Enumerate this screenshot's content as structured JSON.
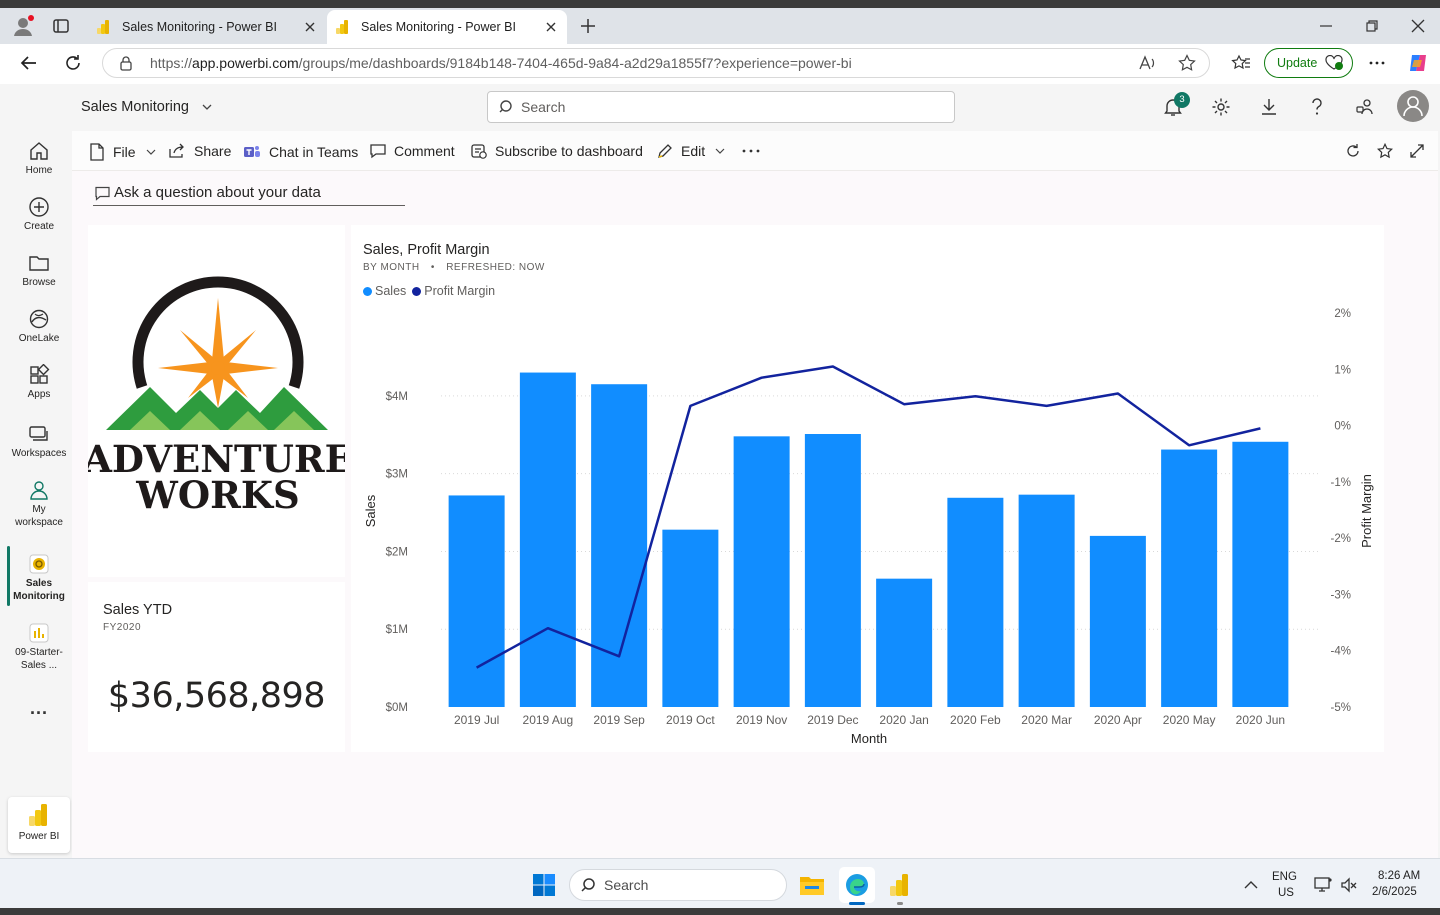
{
  "browser": {
    "tabs": [
      {
        "title": "Sales Monitoring - Power BI",
        "active": false
      },
      {
        "title": "Sales Monitoring - Power BI",
        "active": true
      }
    ],
    "url_prefix": "https://",
    "url_host": "app.powerbi.com",
    "url_path": "/groups/me/dashboards/9184b148-7404-465d-9a84-a2d29a1855f7?experience=power-bi",
    "update_label": "Update"
  },
  "appbar": {
    "workspace_title": "Sales Monitoring",
    "search_placeholder": "Search",
    "notification_count": "3"
  },
  "nav": {
    "items": [
      {
        "label": "Home",
        "icon": "home-icon"
      },
      {
        "label": "Create",
        "icon": "plus-circle-icon"
      },
      {
        "label": "Browse",
        "icon": "folder-icon"
      },
      {
        "label": "OneLake",
        "icon": "onelake-icon"
      },
      {
        "label": "Apps",
        "icon": "apps-icon"
      },
      {
        "label": "Workspaces",
        "icon": "workspaces-icon"
      },
      {
        "label_line1": "My",
        "label_line2": "workspace",
        "icon": "person-icon"
      },
      {
        "label_line1": "Sales",
        "label_line2": "Monitoring",
        "icon": "dashboard-icon",
        "selected": true
      },
      {
        "label_line1": "09-Starter-",
        "label_line2": "Sales ...",
        "icon": "report-icon"
      }
    ],
    "more": "...",
    "brand_label": "Power BI"
  },
  "toolbar": {
    "file": "File",
    "share": "Share",
    "chat_in_teams": "Chat in Teams",
    "comment": "Comment",
    "subscribe": "Subscribe to dashboard",
    "edit": "Edit"
  },
  "qna": {
    "placeholder": "Ask a question about your data"
  },
  "logo": {
    "line1": "ADVENTURE",
    "line2": "WORKS"
  },
  "kpi": {
    "title": "Sales YTD",
    "subtitle": "FY2020",
    "value": "$36,568,898"
  },
  "chart_data": {
    "type": "bar",
    "title": "Sales, Profit Margin",
    "subtitle_left": "BY MONTH",
    "subtitle_sep": "•",
    "subtitle_right": "REFRESHED: NOW",
    "xlabel": "Month",
    "ylabel": "Sales",
    "y2label": "Profit Margin",
    "categories": [
      "2019 Jul",
      "2019 Aug",
      "2019 Sep",
      "2019 Oct",
      "2019 Nov",
      "2019 Dec",
      "2020 Jan",
      "2020 Feb",
      "2020 Mar",
      "2020 Apr",
      "2020 May",
      "2020 Jun"
    ],
    "series": [
      {
        "name": "Sales",
        "type": "bar",
        "axis": "left",
        "color": "#118dff",
        "values": [
          2.72,
          4.3,
          4.15,
          2.28,
          3.48,
          3.51,
          1.65,
          2.69,
          2.73,
          2.2,
          3.31,
          3.41
        ]
      },
      {
        "name": "Profit Margin",
        "type": "line",
        "axis": "right",
        "color": "#12239e",
        "values": [
          -4.3,
          -3.6,
          -4.1,
          0.35,
          0.85,
          1.05,
          0.38,
          0.52,
          0.35,
          0.57,
          -0.35,
          -0.05
        ]
      }
    ],
    "y_ticks": [
      "$0M",
      "$1M",
      "$2M",
      "$3M",
      "$4M"
    ],
    "y_tick_values": [
      0,
      1,
      2,
      3,
      4
    ],
    "y2_ticks": [
      "-5%",
      "-4%",
      "-3%",
      "-2%",
      "-1%",
      "0%",
      "1%",
      "2%"
    ],
    "y2_tick_values": [
      -5,
      -4,
      -3,
      -2,
      -1,
      0,
      1,
      2
    ],
    "ylim": [
      0,
      4.5
    ],
    "y2lim": [
      -5,
      2
    ],
    "legend_position": "top-left",
    "grid": true
  },
  "taskbar": {
    "search_placeholder": "Search",
    "lang_line1": "ENG",
    "lang_line2": "US",
    "time": "8:26 AM",
    "date": "2/6/2025"
  },
  "colors": {
    "accent": "#117865",
    "bar": "#118dff",
    "line": "#12239e"
  }
}
